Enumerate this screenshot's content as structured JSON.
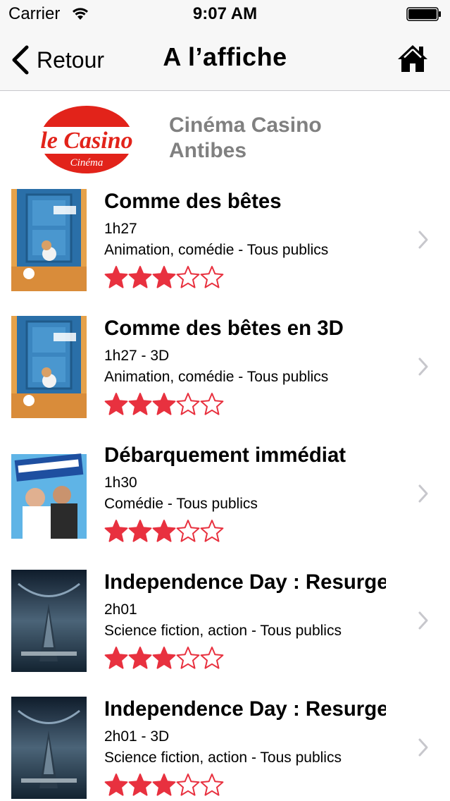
{
  "status_bar": {
    "carrier": "Carrier",
    "time": "9:07 AM"
  },
  "nav": {
    "back_label": "Retour",
    "title": "A l’affiche",
    "home_icon": "home-icon"
  },
  "cinema": {
    "logo_text": "le Casino",
    "logo_subtext": "Cinéma",
    "name_line1": "Cinéma Casino",
    "name_line2": "Antibes"
  },
  "colors": {
    "star_red": "#e8313f",
    "logo_red": "#e2231a",
    "cinema_name_gray": "#808080"
  },
  "films": [
    {
      "title": "Comme des bêtes",
      "duration": "1h27",
      "genre": "Animation, comédie - Tous publics",
      "rating": 3,
      "max_rating": 5,
      "poster": "pets"
    },
    {
      "title": "Comme des bêtes en 3D",
      "duration": "1h27 - 3D",
      "genre": "Animation, comédie - Tous publics",
      "rating": 3,
      "max_rating": 5,
      "poster": "pets"
    },
    {
      "title": "Débarquement immédiat",
      "duration": "1h30",
      "genre": "Comédie - Tous publics",
      "rating": 3,
      "max_rating": 5,
      "poster": "debarquement"
    },
    {
      "title": "Independence Day : Resurgence",
      "duration": "2h01",
      "genre": "Science fiction, action - Tous publics",
      "rating": 3,
      "max_rating": 5,
      "poster": "independence"
    },
    {
      "title": "Independence Day : Resurgence",
      "duration": "2h01 - 3D",
      "genre": "Science fiction, action - Tous publics",
      "rating": 3,
      "max_rating": 5,
      "poster": "independence"
    }
  ]
}
